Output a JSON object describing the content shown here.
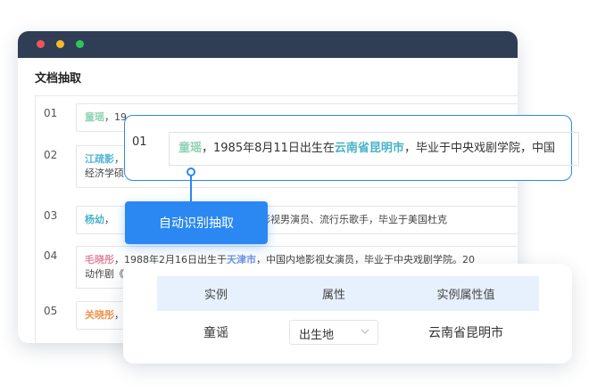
{
  "window": {
    "title": "文档抽取",
    "rows": [
      {
        "num": "01",
        "entity": "童瑶",
        "rest": "，19"
      },
      {
        "num": "02",
        "entity": "江疏影",
        "rest": "，",
        "line2": "经济学硕"
      },
      {
        "num": "03",
        "entity": "杨幼",
        "rest": "，",
        "tail": "中国内地影视男演员、流行乐歌手，毕业于美国杜克"
      },
      {
        "num": "04",
        "entity": "毛晓彤",
        "t1": "，1988年2月16日出生于",
        "place": "天津市",
        "t2": "，中国内地影视女演员，毕业于中央戏剧学院。20",
        "line2": "动作剧《"
      },
      {
        "num": "05",
        "entity": "关晓彤",
        "rest": "，"
      }
    ]
  },
  "callout": {
    "num": "01",
    "entity": "童瑶",
    "t1": "，1985年8月11日出生在",
    "place": "云南省昆明市",
    "t2": "，毕业于中央戏剧学院，中国"
  },
  "extract_button": "自动识别抽取",
  "result_table": {
    "headers": [
      "实例",
      "属性",
      "实例属性值"
    ],
    "row": {
      "instance": "童谣",
      "attribute": "出生地",
      "value": "云南省昆明市"
    }
  },
  "colors": {
    "accent": "#2b88f2",
    "titlebar": "#2f3d55",
    "table_header_bg": "#e6f1fd"
  },
  "icons": [
    "close-dot",
    "minimize-dot",
    "maximize-dot",
    "chevron-down-icon"
  ]
}
